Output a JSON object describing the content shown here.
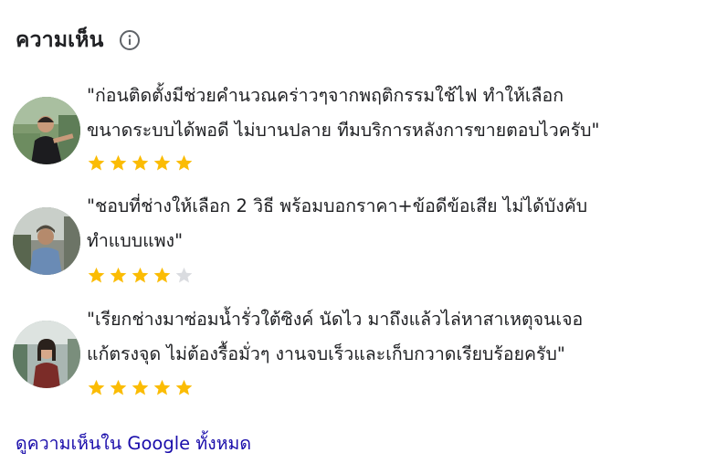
{
  "section": {
    "title": "ความเห็น",
    "info_icon": "info-icon",
    "star_color": "#fbbc04",
    "empty_star_color": "#dadce0",
    "link_color": "#1a0dab"
  },
  "reviews": [
    {
      "line1": "\"ก่อนติดตั้งมีช่วยคำนวณคร่าวๆจากพฤติกรรมใช้ไฟ ทำให้เลือก",
      "line2": "ขนาดระบบได้พอดี ไม่บานปลาย ทีมบริการหลังการขายตอบไวครับ\"",
      "rating": 5,
      "rating_max": 5,
      "avatar": "user-photo"
    },
    {
      "line1": "\"ชอบที่ช่างให้เลือก 2 วิธี พร้อมบอกราคา+ข้อดีข้อเสีย ไม่ได้บังคับ",
      "line2": "ทำแบบแพง\"",
      "rating": 4,
      "rating_max": 5,
      "avatar": "user-photo"
    },
    {
      "line1": "\"เรียกช่างมาซ่อมน้ำรั่วใต้ซิงค์ นัดไว มาถึงแล้วไล่หาสาเหตุจนเจอ",
      "line2": "แก้ตรงจุด ไม่ต้องรื้อมั่วๆ งานจบเร็วและเก็บกวาดเรียบร้อยครับ\"",
      "rating": 5,
      "rating_max": 5,
      "avatar": "user-photo"
    }
  ],
  "footer": {
    "more_link": "ดูความเห็นใน Google ทั้งหมด"
  }
}
